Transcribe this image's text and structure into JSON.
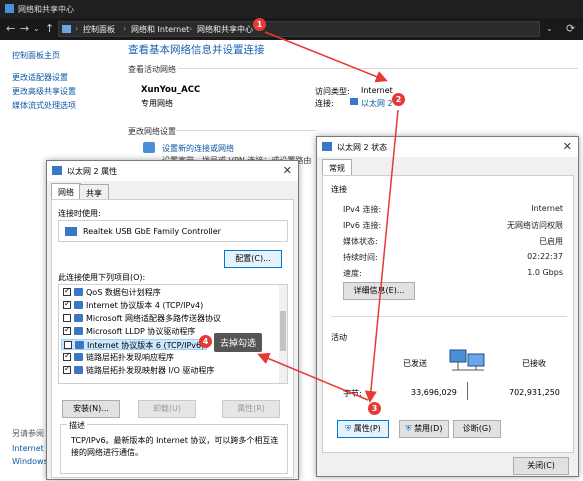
{
  "window": {
    "title": "网络和共享中心",
    "breadcrumb": [
      "控制面板",
      "网络和 Internet",
      "网络和共享中心"
    ]
  },
  "left_links": [
    "控制面板主页",
    "更改适配器设置",
    "更改高级共享设置",
    "媒体流式处理选项"
  ],
  "see_also": {
    "title": "另请参阅",
    "items": [
      "Internet 选",
      "Windows"
    ]
  },
  "main": {
    "heading": "查看基本网络信息并设置连接",
    "active_title": "查看活动网络",
    "network_name": "XunYou_ACC",
    "network_type": "专用网络",
    "access_type_label": "访问类型:",
    "access_type_value": "Internet",
    "connection_label": "连接:",
    "connection_value": "以太网 2",
    "change_title": "更改网络设置",
    "new_connection": "设置新的连接或网络",
    "new_connection_desc": "设置宽带、拨号或 VPN 连接；或设置路由器或接入点。"
  },
  "status_dialog": {
    "title": "以太网 2 状态",
    "tab": "常规",
    "connection_group": "连接",
    "rows": [
      {
        "k": "IPv4 连接:",
        "v": "Internet"
      },
      {
        "k": "IPv6 连接:",
        "v": "无网络访问权限"
      },
      {
        "k": "媒体状态:",
        "v": "已启用"
      },
      {
        "k": "持续时间:",
        "v": "02:22:37"
      },
      {
        "k": "速度:",
        "v": "1.0 Gbps"
      }
    ],
    "details_button": "详细信息(E)...",
    "activity_group": "活动",
    "sent_label": "已发送",
    "received_label": "已接收",
    "bytes_label": "字节:",
    "bytes_sent": "33,696,029",
    "bytes_received": "702,931,250",
    "properties_button": "属性(P)",
    "disable_button": "禁用(D)",
    "diagnose_button": "诊断(G)",
    "close_button": "关闭(C)"
  },
  "props_dialog": {
    "title": "以太网 2 属性",
    "tabs": [
      "网络",
      "共享"
    ],
    "connect_using_label": "连接时使用:",
    "adapter": "Realtek USB GbE Family Controller",
    "configure_button": "配置(C)...",
    "items_label": "此连接使用下列项目(O):",
    "items": [
      {
        "label": "QoS 数据包计划程序",
        "checked": true
      },
      {
        "label": "Internet 协议版本 4 (TCP/IPv4)",
        "checked": true
      },
      {
        "label": "Microsoft 网络适配器多路传送器协议",
        "checked": false
      },
      {
        "label": "Microsoft LLDP 协议驱动程序",
        "checked": true
      },
      {
        "label": "Internet 协议版本 6 (TCP/IPv6)",
        "checked": false
      },
      {
        "label": "链路层拓扑发现响应程序",
        "checked": true
      },
      {
        "label": "链路层拓扑发现映射器 I/O 驱动程序",
        "checked": true
      }
    ],
    "install_button": "安装(N)...",
    "uninstall_button": "卸载(U)",
    "properties_button": "属性(R)",
    "description_label": "描述",
    "description": "TCP/IPv6。最新版本的 Internet 协议，可以跨多个相互连接的网络进行通信。"
  },
  "annotations": {
    "markers": [
      "1",
      "2",
      "3",
      "4"
    ],
    "callout": "去掉勾选",
    "colors": {
      "marker": "#e53935",
      "arrow": "#e53935",
      "selection": "#cce8ff"
    }
  }
}
